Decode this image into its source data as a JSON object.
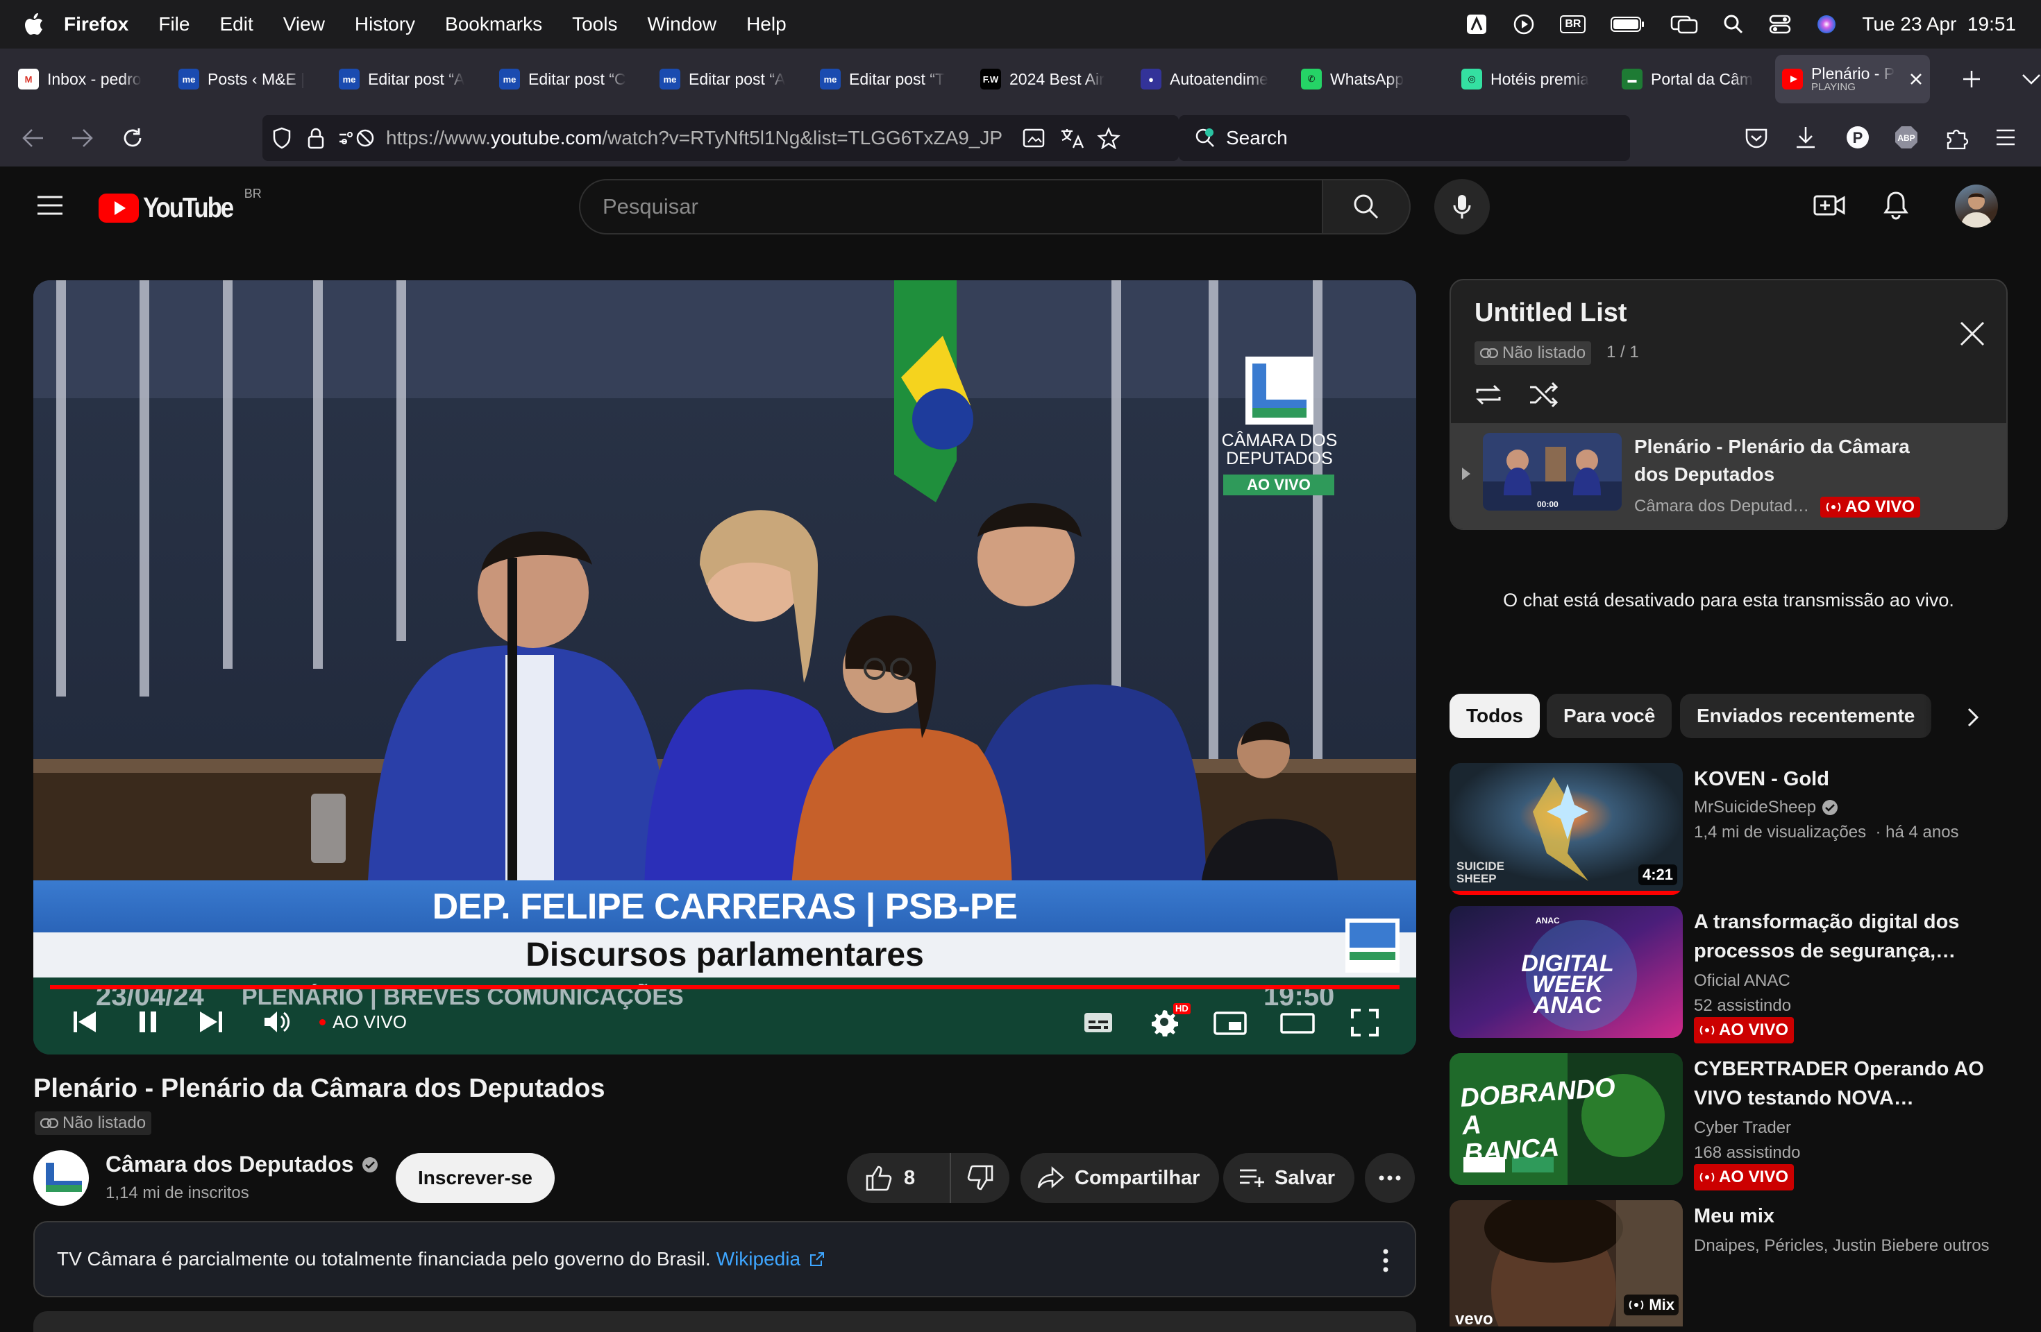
{
  "menubar": {
    "app": "Firefox",
    "items": [
      "File",
      "Edit",
      "View",
      "History",
      "Bookmarks",
      "Tools",
      "Window",
      "Help"
    ],
    "datetime": "Tue 23 Apr  19:51",
    "br_badge": "BR"
  },
  "tabs": [
    {
      "label": "Inbox - pedro",
      "fav": "M",
      "color": "#ffffff"
    },
    {
      "label": "Posts ‹ M&E |",
      "fav": "me",
      "color": "#1a4bb0"
    },
    {
      "label": "Editar post “A",
      "fav": "me",
      "color": "#1a4bb0"
    },
    {
      "label": "Editar post “C",
      "fav": "me",
      "color": "#1a4bb0"
    },
    {
      "label": "Editar post “A",
      "fav": "me",
      "color": "#1a4bb0"
    },
    {
      "label": "Editar post “T",
      "fav": "me",
      "color": "#1a4bb0"
    },
    {
      "label": "2024 Best Air",
      "fav": "F.W",
      "color": "#000000"
    },
    {
      "label": "Autoatendime",
      "fav": "●",
      "color": "#333399"
    },
    {
      "label": "WhatsApp",
      "fav": "✆",
      "color": "#25d366"
    },
    {
      "label": "Hotéis premia",
      "fav": "◎",
      "color": "#34e0a1"
    },
    {
      "label": "Portal da Câm",
      "fav": "▬",
      "color": "#1e7b34"
    }
  ],
  "active_tab": {
    "label": "Plenário - P",
    "sub": "PLAYING"
  },
  "navbar": {
    "url_prefix": "https://www.",
    "url_domain": "youtube.com",
    "url_rest": "/watch?v=RTyNft5l1Ng&list=TLGG6TxZA9_JP",
    "search_placeholder": "Search"
  },
  "youtube": {
    "logo_text": "YouTube",
    "logo_region": "BR",
    "search_placeholder": "Pesquisar"
  },
  "video": {
    "lower_third_name": "DEP. FELIPE CARRERAS | PSB-PE",
    "lower_third_subtitle": "Discursos parlamentares",
    "ticker_date": "23/04/24",
    "ticker_text": "PLENÁRIO | BREVES COMUNICAÇÕES",
    "ticker_time": "19:50",
    "watermark_line1": "CÂMARA DOS",
    "watermark_line2": "DEPUTADOS",
    "watermark_live": "AO VIVO",
    "live_label": "AO VIVO",
    "hd_badge": "HD",
    "mic_text": "DEPUTADOS",
    "progress": 1.0
  },
  "info": {
    "title": "Plenário - Plenário da Câmara dos Deputados",
    "unlisted": "Não listado",
    "channel": "Câmara dos Deputados",
    "subscribers": "1,14 mi de inscritos",
    "subscribe": "Inscrever-se",
    "likes": "8",
    "share": "Compartilhar",
    "save": "Salvar",
    "notice": "TV Câmara é parcialmente ou totalmente financiada pelo governo do Brasil.",
    "notice_link": "Wikipedia"
  },
  "playlist": {
    "title": "Untitled List",
    "privacy": "Não listado",
    "position": "1 / 1",
    "item_title": "Plenário - Plenário da Câmara dos Deputados",
    "item_channel": "Câmara dos Deputad…",
    "item_live": "AO VIVO",
    "thumb_time": "00:00"
  },
  "chat_disabled": "O chat está desativado para esta transmissão ao vivo.",
  "chips": [
    "Todos",
    "Para você",
    "Enviados recentemente"
  ],
  "recommendations": [
    {
      "title": "KOVEN - Gold",
      "channel": "MrSuicideSheep",
      "verified": true,
      "meta": "1,4 mi de visualizações  · há 4 anos",
      "duration": "4:21",
      "thumb_text": "SUICIDE SHEEP"
    },
    {
      "title": "A transformação digital dos processos de segurança,…",
      "channel": "Oficial ANAC",
      "meta": "52 assistindo",
      "live": "AO VIVO",
      "thumb_text": "DIGITAL WEEK ANAC",
      "thumb_small": "ANAC"
    },
    {
      "title": "CYBERTRADER Operando AO VIVO testando NOVA…",
      "channel": "Cyber Trader",
      "meta": "168 assistindo",
      "live": "AO VIVO",
      "thumb_text": "DOBRANDO A BANCA"
    },
    {
      "title": "Meu mix",
      "channel": "Dnaipes, Péricles, Justin Biebere outros",
      "badge": "Mix",
      "thumb_text": "vevo"
    }
  ]
}
